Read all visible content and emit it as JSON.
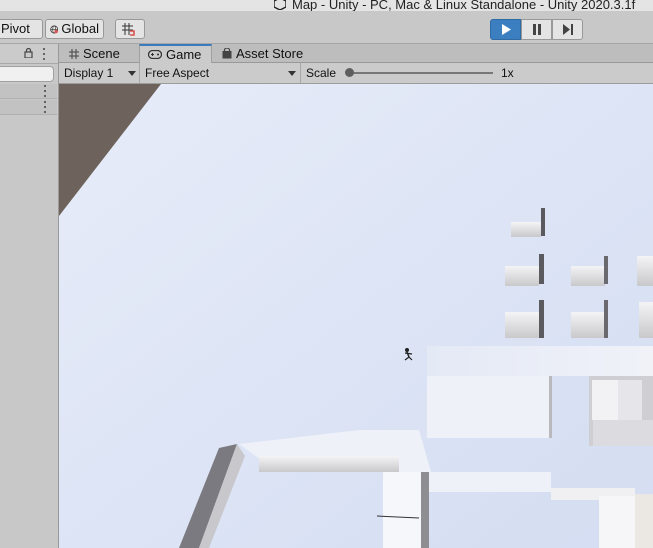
{
  "window": {
    "title": "Map - Unity - PC, Mac & Linux Standalone - Unity 2020.3.1f"
  },
  "toolbar": {
    "pivot_label": "Pivot",
    "global_label": "Global",
    "play_active": true
  },
  "tabs": [
    {
      "label": "Scene",
      "icon": "hash-grid-icon"
    },
    {
      "label": "Game",
      "icon": "gamepad-icon",
      "active": true
    },
    {
      "label": "Asset Store",
      "icon": "shopping-bag-icon"
    }
  ],
  "game_toolbar": {
    "display_label": "Display 1",
    "aspect_label": "Free Aspect",
    "scale_label": "Scale",
    "scale_value": "1x"
  },
  "colors": {
    "accent": "#3c7fc1",
    "sky_floor": "#dde4f4",
    "cliff": "#6e625c"
  }
}
